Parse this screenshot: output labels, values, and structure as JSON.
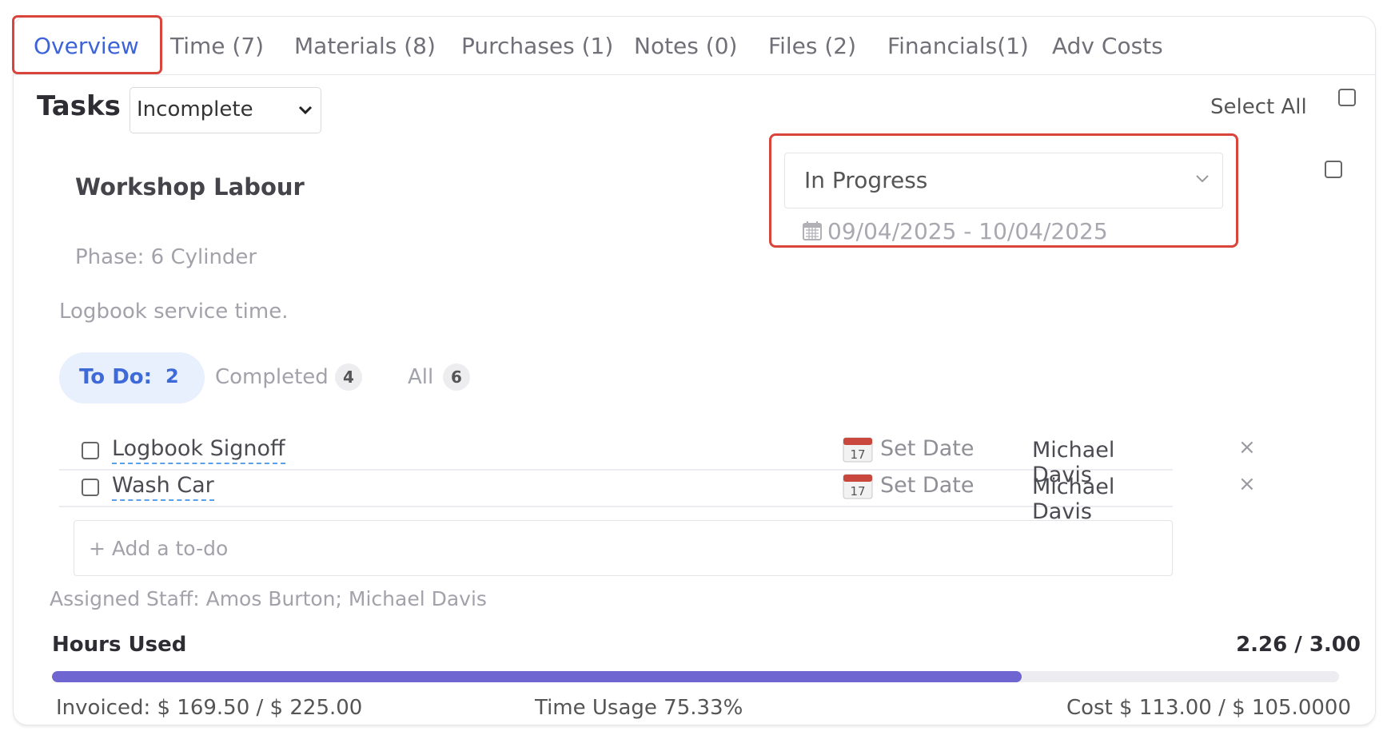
{
  "tabs": [
    {
      "label": "Overview"
    },
    {
      "label": "Time (7)"
    },
    {
      "label": "Materials (8)"
    },
    {
      "label": "Purchases (1)"
    },
    {
      "label": "Notes (0)"
    },
    {
      "label": "Files (2)"
    },
    {
      "label": "Financials(1)"
    },
    {
      "label": "Adv Costs"
    }
  ],
  "tasks": {
    "title": "Tasks",
    "filter_value": "Incomplete",
    "select_all_label": "Select All"
  },
  "task": {
    "name": "Workshop Labour",
    "phase": "Phase: 6 Cylinder",
    "description": "Logbook service time.",
    "status": "In Progress",
    "date_range": "09/04/2025 - 10/04/2025",
    "assigned_staff": "Assigned Staff: Amos Burton; Michael Davis"
  },
  "filters": {
    "todo_label": "To Do:",
    "todo_count": "2",
    "completed_label": "Completed",
    "completed_count": "4",
    "all_label": "All",
    "all_count": "6"
  },
  "todos": [
    {
      "name": "Logbook Signoff",
      "date": "Set Date",
      "assignee": "Michael Davis",
      "delete": "×"
    },
    {
      "name": "Wash Car",
      "date": "Set Date",
      "assignee": "Michael Davis",
      "delete": "×"
    }
  ],
  "add_todo_placeholder": "+ Add a to-do",
  "calendar_icon_day": "17",
  "hours": {
    "label": "Hours Used",
    "value": "2.26 / 3.00",
    "progress_percent": 75.33
  },
  "footer": {
    "invoiced": "Invoiced: $ 169.50 / $ 225.00",
    "time_usage": "Time Usage 75.33%",
    "cost": "Cost $ 113.00 / $ 105.0000"
  },
  "colors": {
    "accent": "#3d63d8",
    "highlight": "#d9443b",
    "progress": "#6f66d1"
  }
}
